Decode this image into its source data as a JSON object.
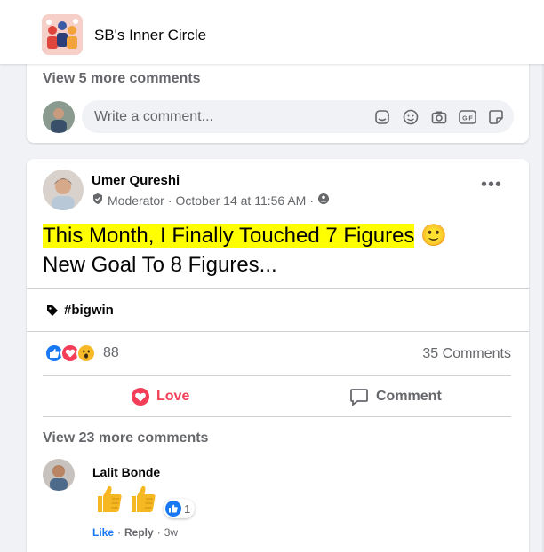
{
  "group": {
    "name": "SB's Inner Circle"
  },
  "previous_card": {
    "view_more": "View 5 more comments",
    "comment_placeholder": "Write a comment...",
    "composer_icons": [
      "avatar-sticker-icon",
      "emoji-icon",
      "camera-icon",
      "gif-icon",
      "sticker-icon"
    ],
    "gif_label": "GIF"
  },
  "post": {
    "author": "Umer Qureshi",
    "role": "Moderator",
    "separator": "·",
    "date": "October 14 at 11:56 AM",
    "more": "•••",
    "text_line1": "This Month, I Finally Touched 7 Figures",
    "emoji": "🙂",
    "text_line2": "New Goal To 8 Figures...",
    "tag": "#bigwin",
    "reaction_count": "88",
    "comments_count": "35 Comments",
    "love_label": "Love",
    "comment_label": "Comment",
    "view_more": "View 23 more comments",
    "colors": {
      "love": "#f33e58",
      "like": "#1877f2",
      "highlight": "#ffff00"
    }
  },
  "comment": {
    "author": "Lalit Bonde",
    "reaction_count": "1",
    "like": "Like",
    "dot": "·",
    "reply": "Reply",
    "time": "3w"
  }
}
